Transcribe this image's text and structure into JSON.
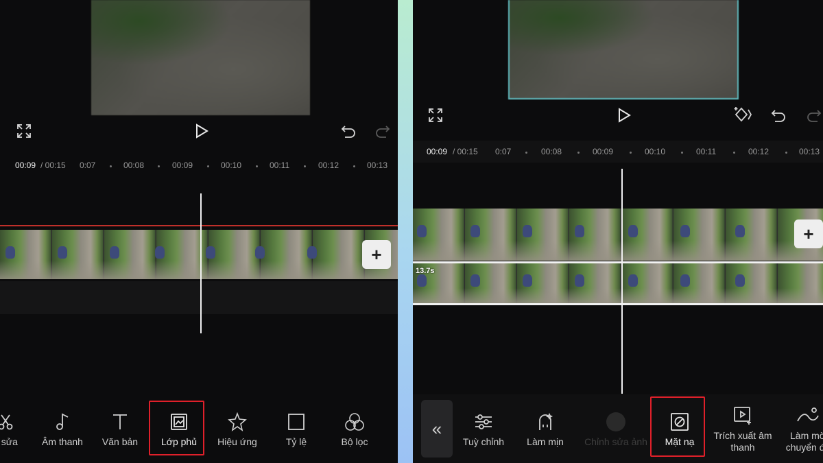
{
  "left": {
    "time_current": "00:09",
    "time_total": "/ 00:15",
    "ticks": [
      "0:07",
      "00:08",
      "00:09",
      "00:10",
      "00:11",
      "00:12",
      "00:13"
    ],
    "toolbar": [
      {
        "label": "h sửa",
        "icon": "scissors-icon"
      },
      {
        "label": "Âm thanh",
        "icon": "music-note-icon"
      },
      {
        "label": "Văn bản",
        "icon": "text-icon"
      },
      {
        "label": "Lớp phủ",
        "icon": "overlay-icon"
      },
      {
        "label": "Hiệu ứng",
        "icon": "effects-star-icon"
      },
      {
        "label": "Tỷ lệ",
        "icon": "ratio-square-icon"
      },
      {
        "label": "Bộ lọc",
        "icon": "filter-circles-icon"
      }
    ],
    "highlighted_tool": "Lớp phủ",
    "add_button": "+"
  },
  "right": {
    "time_current": "00:09",
    "time_total": "/ 00:15",
    "ticks": [
      "0:07",
      "00:08",
      "00:09",
      "00:10",
      "00:11",
      "00:12",
      "00:13"
    ],
    "overlay_duration": "13.7s",
    "collapse_button": "«",
    "toolbar": [
      {
        "label": "Tuỳ chỉnh",
        "icon": "sliders-icon"
      },
      {
        "label": "Làm mịn",
        "icon": "smooth-face-icon"
      },
      {
        "label": "Chỉnh sửa ảnh",
        "icon": "edit-photo-icon"
      },
      {
        "label": "Mặt nạ",
        "icon": "mask-icon"
      },
      {
        "label": "Trích xuất âm thanh",
        "icon": "extract-audio-icon"
      },
      {
        "label": "Làm mờ chuyển độ",
        "icon": "transition-icon"
      }
    ],
    "highlighted_tool": "Mặt nạ",
    "add_button": "+"
  },
  "colors": {
    "background": "#0c0c0d",
    "highlight": "#e0202a",
    "overlay_border": "#5fb8bc",
    "divider_gradient": "#b9ecd0"
  }
}
